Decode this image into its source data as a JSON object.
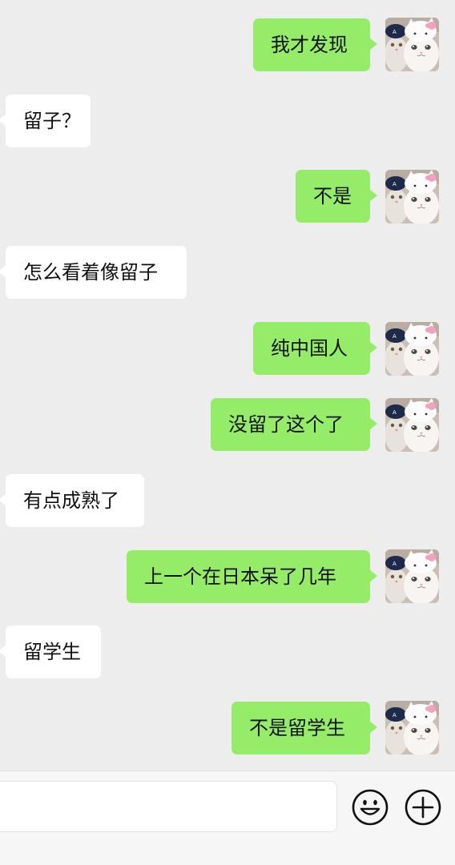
{
  "messages": [
    {
      "side": "right",
      "text": "我才发现"
    },
    {
      "side": "left",
      "text": "留子？"
    },
    {
      "side": "right",
      "text": "不是"
    },
    {
      "side": "left",
      "text": "怎么看着像留子"
    },
    {
      "side": "right",
      "text": "纯中国人"
    },
    {
      "side": "right",
      "text": "没留了这个了"
    },
    {
      "side": "left",
      "text": "有点成熟了"
    },
    {
      "side": "right",
      "text": "上一个在日本呆了几年"
    },
    {
      "side": "left",
      "text": "留学生"
    },
    {
      "side": "right",
      "text": "不是留学生"
    }
  ],
  "input": {
    "value": "",
    "placeholder": ""
  },
  "toolbar": {
    "emoji_icon": "smiley-face-icon",
    "plus_icon": "plus-circle-icon"
  },
  "colors": {
    "background": "#ededed",
    "sent_bubble": "#95ec69",
    "received_bubble": "#ffffff"
  }
}
